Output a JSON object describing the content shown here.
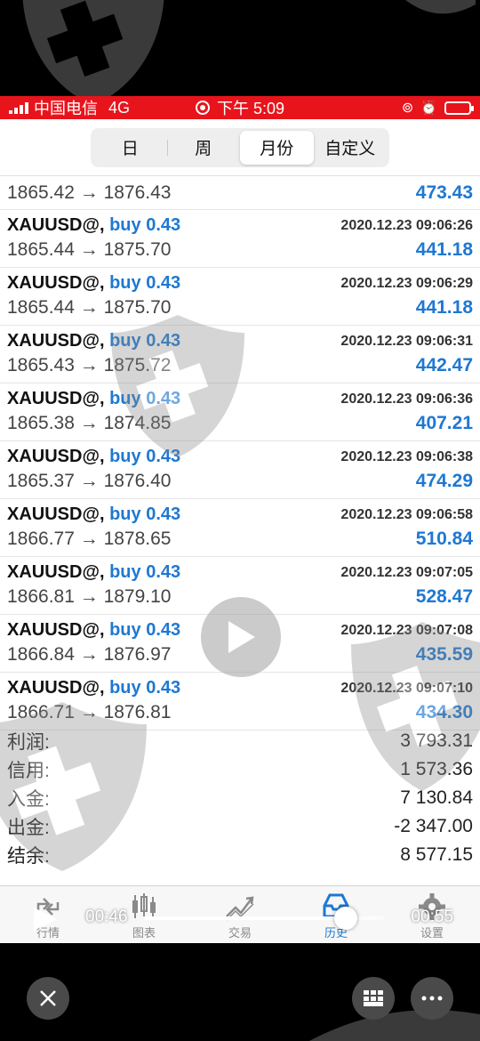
{
  "status_bar": {
    "carrier": "中国电信",
    "network": "4G",
    "time": "下午 5:09"
  },
  "period_tabs": [
    {
      "label": "日",
      "selected": false
    },
    {
      "label": "周",
      "selected": false
    },
    {
      "label": "月份",
      "selected": true
    },
    {
      "label": "自定义",
      "selected": false
    }
  ],
  "partial_row": {
    "prices": "1865.42 → 1876.43",
    "profit": "473.43"
  },
  "trades": [
    {
      "symbol": "XAUUSD@,",
      "direction": "buy 0.43",
      "time": "2020.12.23 09:06:26",
      "prices": "1865.44 → 1875.70",
      "profit": "441.18"
    },
    {
      "symbol": "XAUUSD@,",
      "direction": "buy 0.43",
      "time": "2020.12.23 09:06:29",
      "prices": "1865.44 → 1875.70",
      "profit": "441.18"
    },
    {
      "symbol": "XAUUSD@,",
      "direction": "buy 0.43",
      "time": "2020.12.23 09:06:31",
      "prices": "1865.43 → 1875.72",
      "profit": "442.47"
    },
    {
      "symbol": "XAUUSD@,",
      "direction": "buy 0.43",
      "time": "2020.12.23 09:06:36",
      "prices": "1865.38 → 1874.85",
      "profit": "407.21"
    },
    {
      "symbol": "XAUUSD@,",
      "direction": "buy 0.43",
      "time": "2020.12.23 09:06:38",
      "prices": "1865.37 → 1876.40",
      "profit": "474.29"
    },
    {
      "symbol": "XAUUSD@,",
      "direction": "buy 0.43",
      "time": "2020.12.23 09:06:58",
      "prices": "1866.77 → 1878.65",
      "profit": "510.84"
    },
    {
      "symbol": "XAUUSD@,",
      "direction": "buy 0.43",
      "time": "2020.12.23 09:07:05",
      "prices": "1866.81 → 1879.10",
      "profit": "528.47"
    },
    {
      "symbol": "XAUUSD@,",
      "direction": "buy 0.43",
      "time": "2020.12.23 09:07:08",
      "prices": "1866.84 → 1876.97",
      "profit": "435.59"
    },
    {
      "symbol": "XAUUSD@,",
      "direction": "buy 0.43",
      "time": "2020.12.23 09:07:10",
      "prices": "1866.71 → 1876.81",
      "profit": "434.30"
    }
  ],
  "summary": [
    {
      "label": "利润:",
      "value": "3 793.31"
    },
    {
      "label": "信用:",
      "value": "1 573.36"
    },
    {
      "label": "入金:",
      "value": "7 130.84"
    },
    {
      "label": "出金:",
      "value": "-2 347.00"
    },
    {
      "label": "结余:",
      "value": "8 577.15"
    }
  ],
  "bottom_tabs": [
    {
      "label": "行情",
      "icon": "quotes-icon",
      "active": false
    },
    {
      "label": "图表",
      "icon": "chart-icon",
      "active": false
    },
    {
      "label": "交易",
      "icon": "trade-icon",
      "active": false
    },
    {
      "label": "历史",
      "icon": "history-icon",
      "active": true
    },
    {
      "label": "设置",
      "icon": "settings-icon",
      "active": false
    }
  ],
  "video_player": {
    "current_time": "00:46",
    "total_time": "00:55",
    "progress_fraction": 0.84
  },
  "colors": {
    "status_bar": "#e8141c",
    "accent_blue": "#1e78d2"
  }
}
